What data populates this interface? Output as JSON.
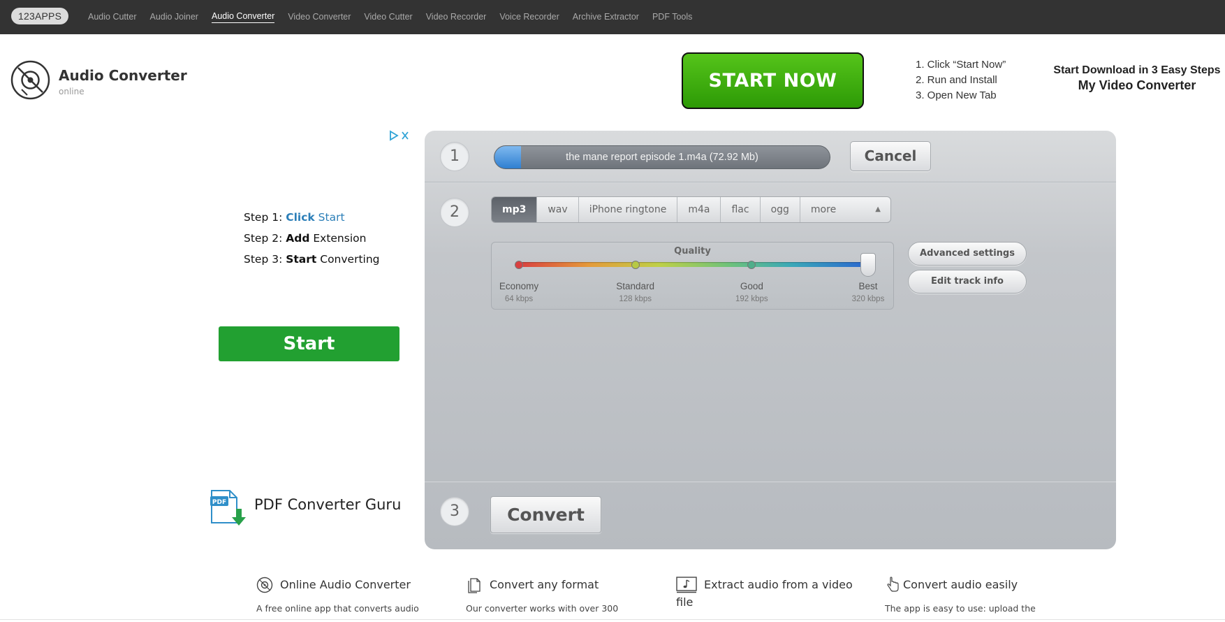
{
  "nav": {
    "logo": "123APPS",
    "links": [
      {
        "label": "Audio Cutter"
      },
      {
        "label": "Audio Joiner"
      },
      {
        "label": "Audio Converter",
        "active": true
      },
      {
        "label": "Video Converter"
      },
      {
        "label": "Video Cutter"
      },
      {
        "label": "Video Recorder"
      },
      {
        "label": "Voice Recorder"
      },
      {
        "label": "Archive Extractor"
      },
      {
        "label": "PDF Tools"
      }
    ]
  },
  "header": {
    "title": "Audio Converter",
    "subtitle": "online",
    "icon": "vinyl-disc-icon"
  },
  "top_ad": {
    "button_label": "START NOW",
    "steps": [
      "1. Click “Start Now”",
      "2. Run and Install",
      "3. Open New Tab"
    ],
    "right_line1": "Start Download in 3 Easy Steps",
    "right_line2": "My Video Converter",
    "accent": "#3aaa0e"
  },
  "left_ad": {
    "adchoices_icon": "adchoices-icon",
    "step1_prefix": "Step 1: ",
    "step1_bold": "Click",
    "step1_rest": " Start",
    "step2_prefix": "Step 2: ",
    "step2_bold": "Add",
    "step2_rest": " Extension",
    "step3_prefix": "Step 3: ",
    "step3_bold": "Start",
    "step3_rest": " Converting",
    "start_label": "Start",
    "brand_text": "PDF Converter Guru",
    "brand_icon": "pdf-download-icon",
    "accent": "#22a031"
  },
  "converter": {
    "step1_num": "1",
    "step2_num": "2",
    "step3_num": "3",
    "file_label": "the mane report episode 1.m4a (72.92 Mb)",
    "upload_progress": 0.08,
    "cancel_label": "Cancel",
    "formats": [
      {
        "label": "mp3",
        "active": true
      },
      {
        "label": "wav"
      },
      {
        "label": "iPhone ringtone"
      },
      {
        "label": "m4a"
      },
      {
        "label": "flac"
      },
      {
        "label": "ogg"
      },
      {
        "label": "more"
      }
    ],
    "quality": {
      "title": "Quality",
      "selected_index": 3,
      "levels": [
        {
          "name": "Economy",
          "bitrate": "64 kbps",
          "color": "#d94040"
        },
        {
          "name": "Standard",
          "bitrate": "128 kbps",
          "color": "#b7c945"
        },
        {
          "name": "Good",
          "bitrate": "192 kbps",
          "color": "#4fae8a"
        },
        {
          "name": "Best",
          "bitrate": "320 kbps",
          "color": "#2b66d0"
        }
      ]
    },
    "advanced_label": "Advanced settings",
    "edit_track_label": "Edit track info",
    "convert_label": "Convert"
  },
  "features": [
    {
      "icon": "disc-icon",
      "title": "Online Audio Converter",
      "desc": "A free online app that converts audio"
    },
    {
      "icon": "documents-icon",
      "title": "Convert any format",
      "desc": "Our converter works with over 300"
    },
    {
      "icon": "music-note-icon",
      "title": "Extract audio from a video",
      "title2": "file"
    },
    {
      "icon": "pointer-hand-icon",
      "title": "Convert audio easily",
      "desc": "The app is easy to use: upload the"
    }
  ]
}
